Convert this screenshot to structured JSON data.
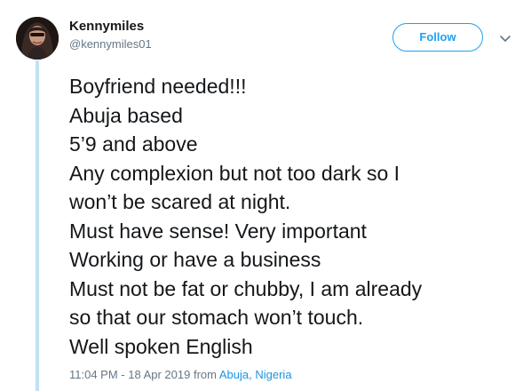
{
  "user": {
    "display_name": "Kennymiles",
    "handle": "@kennymiles01"
  },
  "follow_label": "Follow",
  "icons": {
    "avatar": "profile-photo",
    "more": "chevron-down-icon"
  },
  "colors": {
    "accent": "#1da1f2",
    "link": "#1b95e0",
    "thread_line": "#c4e0f5",
    "secondary_text": "#657786"
  },
  "tweet_lines": [
    "Boyfriend needed!!!",
    "Abuja based",
    "5’9 and above",
    "Any complexion but not too dark so I",
    "won’t be scared at night.",
    "Must have sense! Very important",
    "Working or have a business",
    "Must not be fat or chubby, I am already",
    "so that our stomach won’t touch.",
    "Well spoken English"
  ],
  "meta": {
    "timestamp": "11:04 PM - 18 Apr 2019",
    "from_text": "from",
    "location": "Abuja, Nigeria"
  }
}
